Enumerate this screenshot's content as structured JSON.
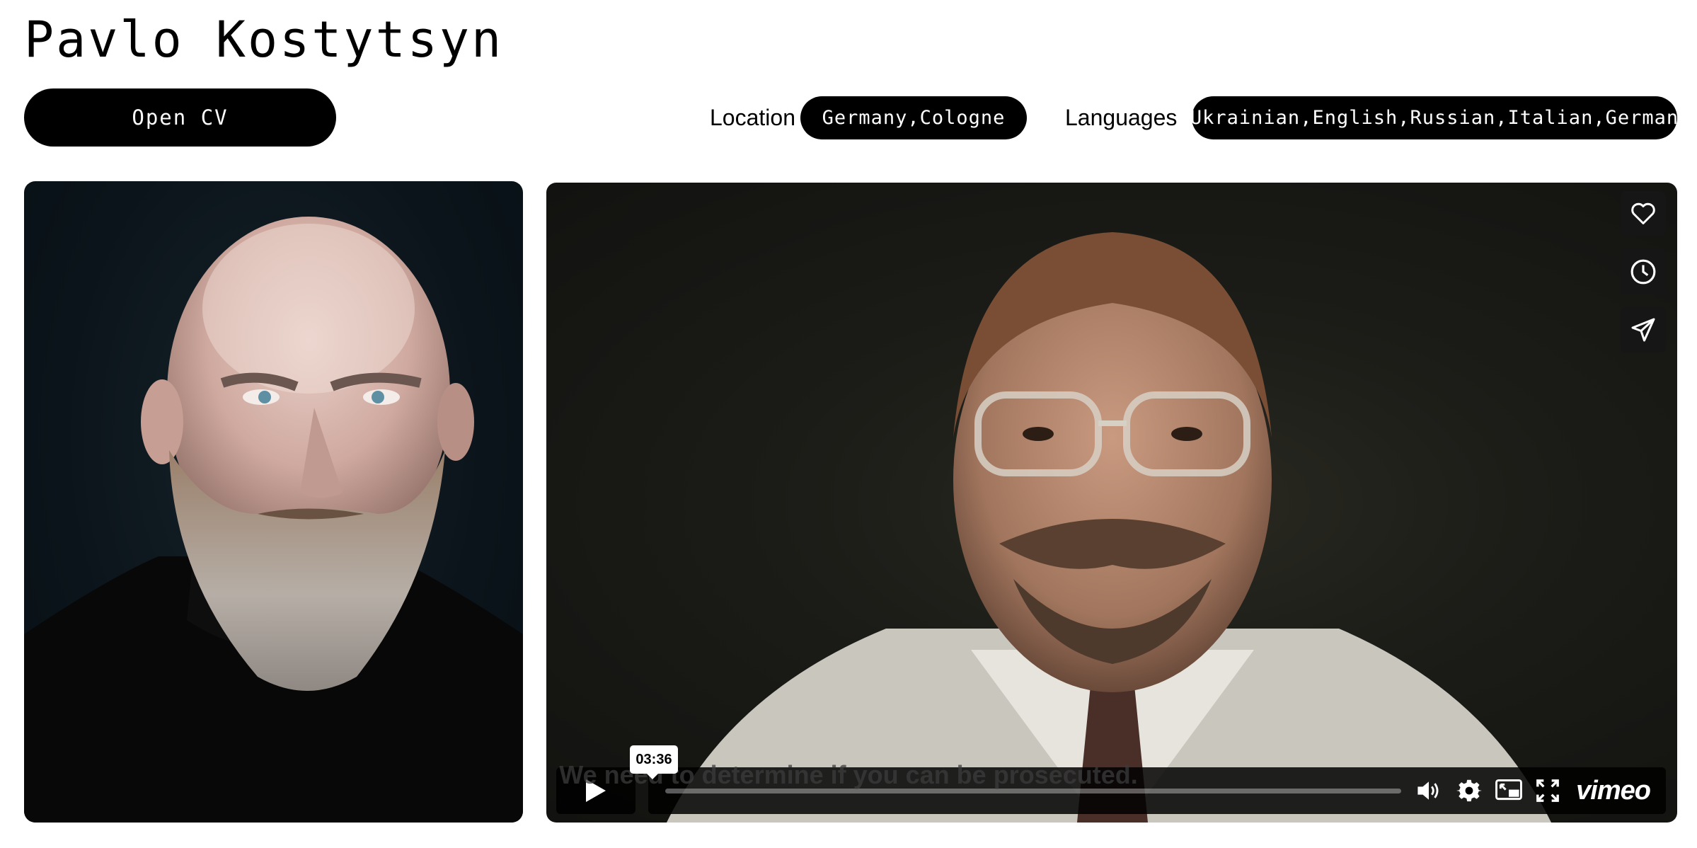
{
  "header": {
    "name": "Pavlo Kostytsyn",
    "cv_button": "Open CV"
  },
  "meta": {
    "location_label": "Location",
    "location_value": "Germany,Cologne",
    "languages_label": "Languages",
    "languages_value": "Ukrainian,English,Russian,Italian,German"
  },
  "video": {
    "tooltip_time": "03:36",
    "subtitle": "We need to determine if you can be prosecuted.",
    "brand": "vimeo",
    "side_icons": [
      "heart-icon",
      "clock-icon",
      "send-icon"
    ],
    "controls": [
      "play-icon",
      "volume-icon",
      "settings-icon",
      "pip-icon",
      "fullscreen-icon"
    ]
  }
}
